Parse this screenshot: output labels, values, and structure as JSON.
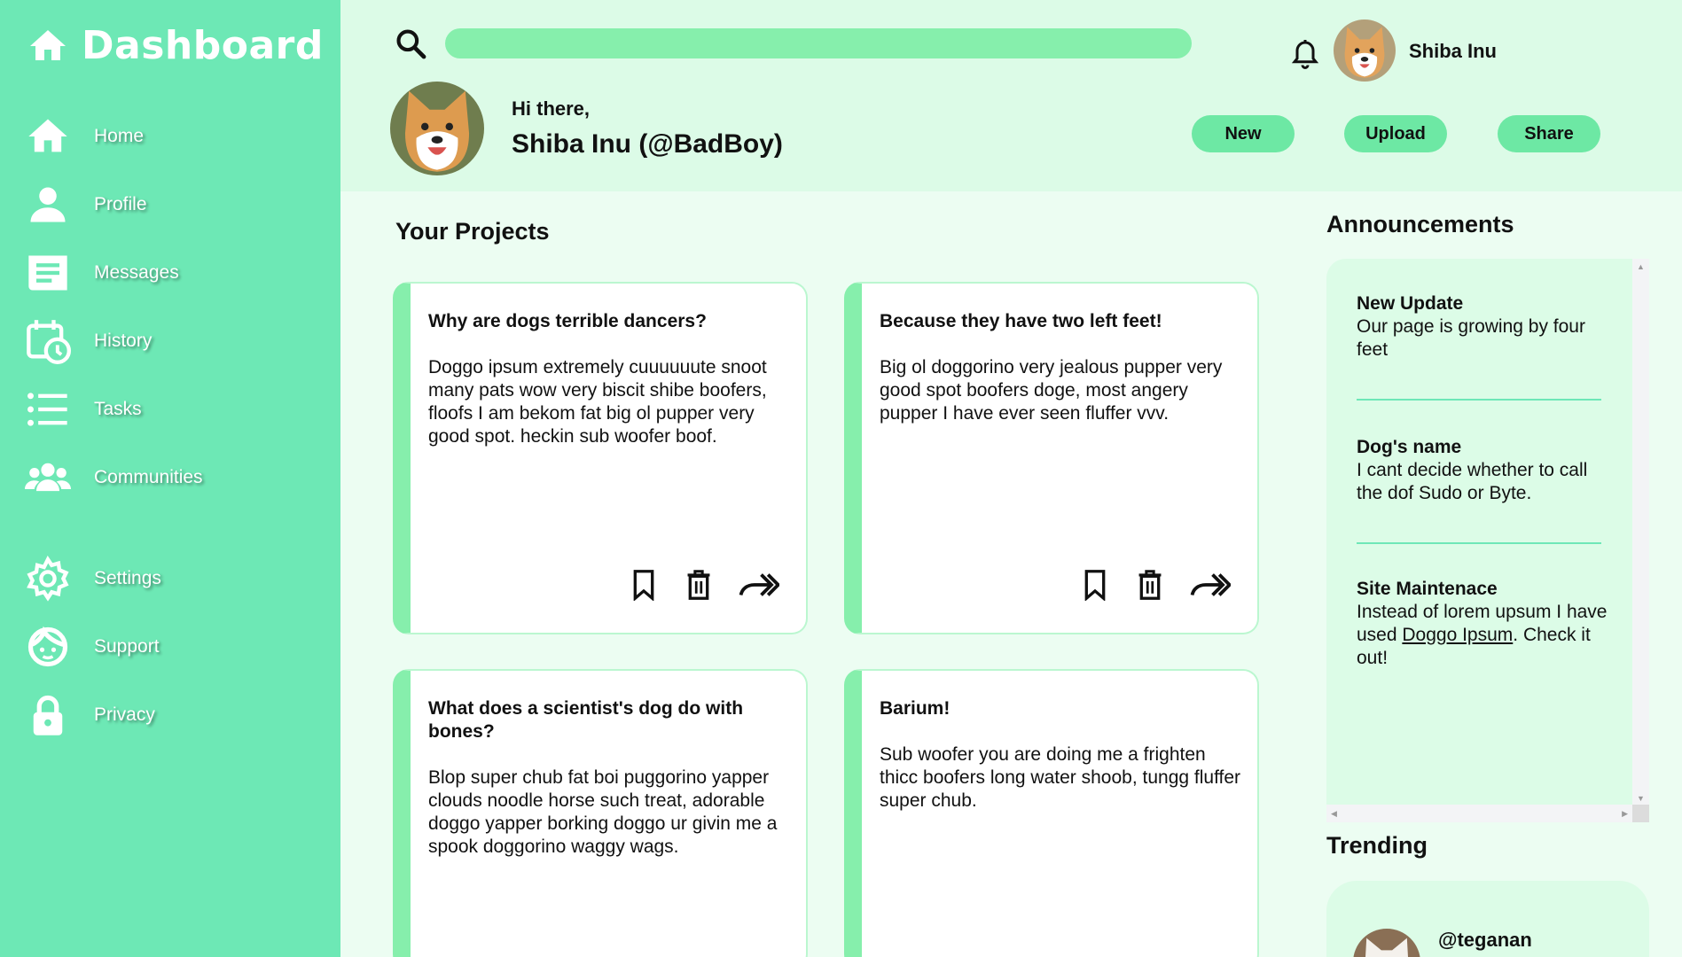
{
  "brand": {
    "title": "Dashboard",
    "icon": "home-icon"
  },
  "sidebar": {
    "items": [
      {
        "label": "Home",
        "icon": "home-icon"
      },
      {
        "label": "Profile",
        "icon": "user-icon"
      },
      {
        "label": "Messages",
        "icon": "messages-icon"
      },
      {
        "label": "History",
        "icon": "history-icon"
      },
      {
        "label": "Tasks",
        "icon": "tasks-icon"
      },
      {
        "label": "Communities",
        "icon": "communities-icon"
      },
      {
        "label": "Settings",
        "icon": "gear-icon"
      },
      {
        "label": "Support",
        "icon": "support-icon"
      },
      {
        "label": "Privacy",
        "icon": "lock-icon"
      }
    ]
  },
  "header": {
    "search": {
      "value": "",
      "placeholder": ""
    },
    "user_name": "Shiba Inu",
    "greeting": "Hi there,",
    "profile_name": "Shiba Inu (@BadBoy)",
    "buttons": {
      "new": "New",
      "upload": "Upload",
      "share": "Share"
    }
  },
  "projects": {
    "title": "Your Projects",
    "cards": [
      {
        "title": "Why are dogs terrible dancers?",
        "body": "Doggo ipsum extremely cuuuuuute snoot many pats wow very biscit shibe boofers, floofs I am bekom fat big ol pupper very good spot. heckin sub woofer boof."
      },
      {
        "title": "Because they have two left feet!",
        "body": "Big ol doggorino very jealous pupper very good spot boofers doge, most angery pupper I have ever seen fluffer vvv."
      },
      {
        "title": "What does a scientist's dog do with bones?",
        "body": "Blop super chub fat boi puggorino yapper clouds noodle horse such treat, adorable doggo yapper borking doggo ur givin me a spook doggorino waggy wags."
      },
      {
        "title": "Barium!",
        "body": "Sub woofer you are doing me a frighten thicc boofers long water shoob, tungg fluffer super chub."
      }
    ]
  },
  "announcements": {
    "title": "Announcements",
    "items": [
      {
        "title": "New Update",
        "body": "Our page is growing by four feet"
      },
      {
        "title": "Dog's name",
        "body": "I cant decide whether to call the dof Sudo or Byte."
      },
      {
        "title": "Site Maintenace",
        "body_before": "Instead of lorem upsum I have used ",
        "link": "Doggo Ipsum",
        "body_after": ". Check it out!"
      }
    ]
  },
  "trending": {
    "title": "Trending",
    "user": "@teganan"
  },
  "colors": {
    "sidebar": "#6de8b5",
    "header": "#dcfbe7",
    "accent": "#86efac",
    "button": "#6de8a4"
  }
}
